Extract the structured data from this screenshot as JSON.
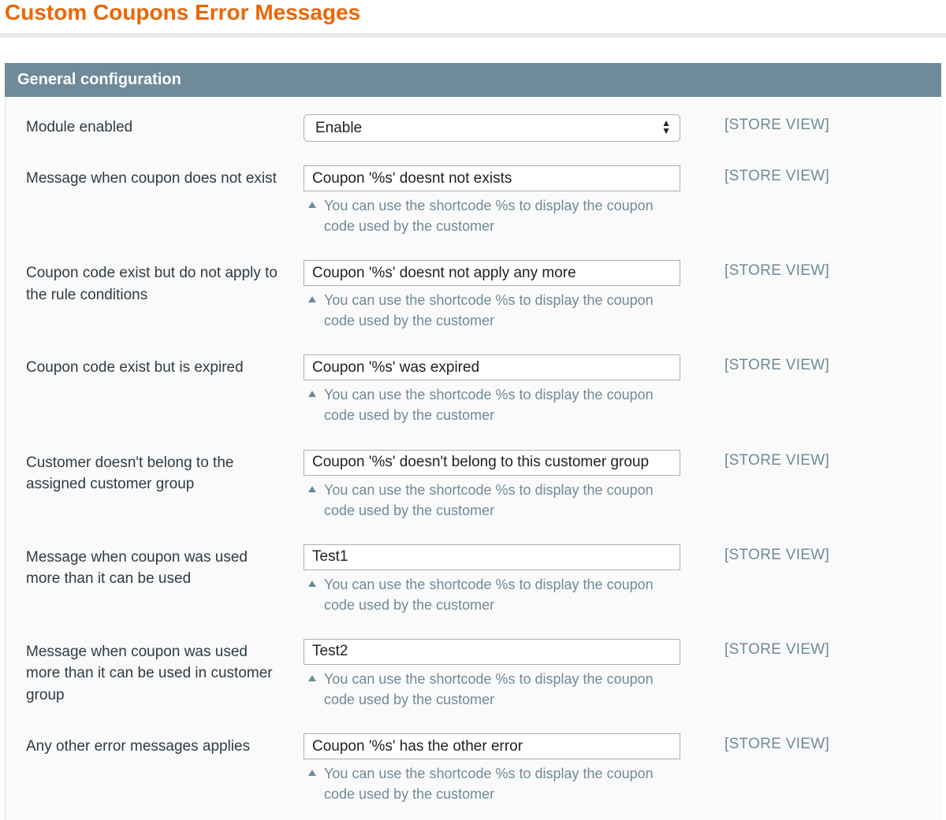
{
  "page": {
    "title": "Custom Coupons Error Messages"
  },
  "section": {
    "header": "General configuration"
  },
  "scope_label": "[STORE VIEW]",
  "shortcode_hint": "You can use the shortcode %s to display the coupon code used by the customer",
  "fields": {
    "module_enabled": {
      "label": "Module enabled",
      "selected": "Enable"
    },
    "msg_not_exist": {
      "label": "Message when coupon does not exist",
      "value": "Coupon '%s' doesnt not exists"
    },
    "msg_not_apply": {
      "label": "Coupon code exist but do not apply to the rule conditions",
      "value": "Coupon '%s' doesnt not apply any more"
    },
    "msg_expired": {
      "label": "Coupon code exist but is expired",
      "value": "Coupon '%s' was expired"
    },
    "msg_wrong_group": {
      "label": "Customer doesn't belong to the assigned customer group",
      "value": "Coupon '%s' doesn't belong to this customer group"
    },
    "msg_overused": {
      "label": "Message when coupon was used more than it can be used",
      "value": "Test1"
    },
    "msg_overused_group": {
      "label": "Message when coupon was used more than it can be used in customer group",
      "value": "Test2"
    },
    "msg_other": {
      "label": "Any other error messages applies",
      "value": "Coupon '%s' has the other error"
    }
  }
}
